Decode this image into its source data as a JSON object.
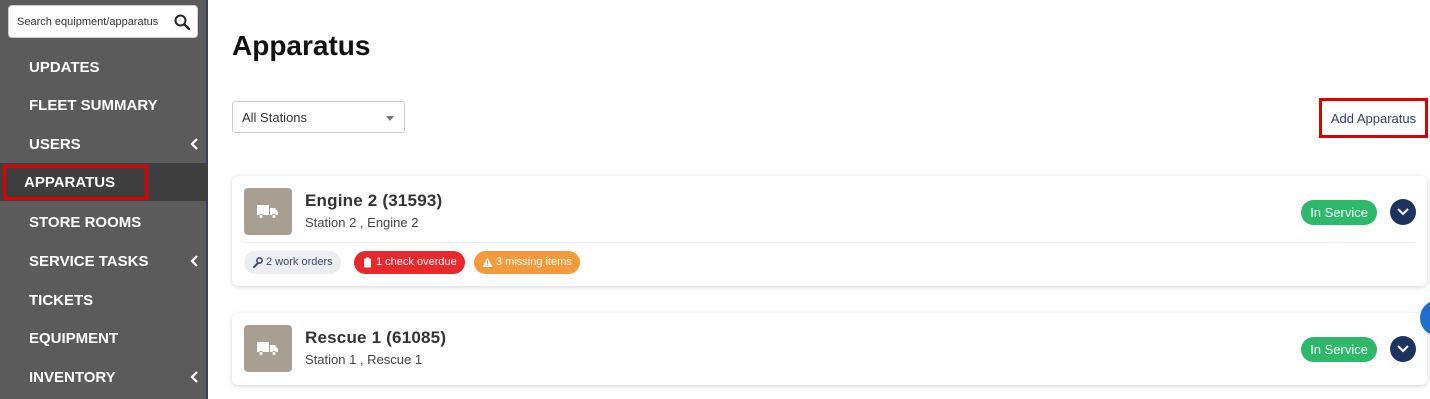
{
  "sidebar": {
    "search_placeholder": "Search equipment/apparatus",
    "items": [
      {
        "label": "UPDATES",
        "has_chevron": false
      },
      {
        "label": "FLEET SUMMARY",
        "has_chevron": false
      },
      {
        "label": "USERS",
        "has_chevron": true
      },
      {
        "label": "APPARATUS",
        "has_chevron": false,
        "active": true
      },
      {
        "label": "STORE ROOMS",
        "has_chevron": false
      },
      {
        "label": "SERVICE TASKS",
        "has_chevron": true
      },
      {
        "label": "TICKETS",
        "has_chevron": false
      },
      {
        "label": "EQUIPMENT",
        "has_chevron": false
      },
      {
        "label": "INVENTORY",
        "has_chevron": true
      }
    ]
  },
  "main": {
    "title": "Apparatus",
    "station_filter": "All Stations",
    "add_button": "Add Apparatus",
    "apparatus": [
      {
        "name": "Engine 2 (31593)",
        "subtitle": "Station 2 , Engine 2",
        "status": "In Service",
        "badges": {
          "work_orders": "2 work orders",
          "check_overdue": "1 check overdue",
          "missing_items": "3 missing items"
        }
      },
      {
        "name": "Rescue 1 (61085)",
        "subtitle": "Station 1 , Rescue 1",
        "status": "In Service"
      }
    ]
  },
  "colors": {
    "sidebar_bg": "#5b5b5b",
    "highlight_red": "#e00000",
    "status_green": "#2db86a",
    "expand_navy": "#1d3461",
    "badge_red": "#e8282b",
    "badge_orange": "#f59a3b"
  },
  "icons": [
    "search-icon",
    "chevron-left-icon",
    "truck-icon",
    "chevron-down-icon",
    "wrench-icon",
    "clipboard-icon",
    "warning-icon"
  ]
}
